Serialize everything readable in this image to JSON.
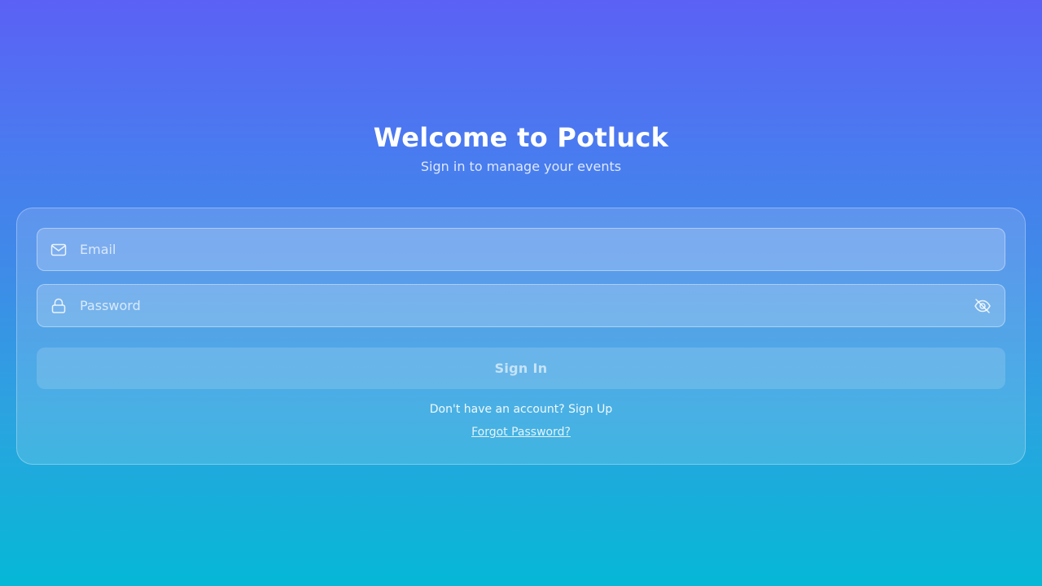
{
  "header": {
    "title": "Welcome to Potluck",
    "subtitle": "Sign in to manage your events"
  },
  "form": {
    "email": {
      "placeholder": "Email",
      "value": "",
      "icon": "mail-icon"
    },
    "password": {
      "placeholder": "Password",
      "value": "",
      "icon": "lock-icon",
      "toggle_icon": "eye-off-icon"
    },
    "submit_label": "Sign In",
    "signup_prompt": "Don't have an account?",
    "signup_link": "Sign Up",
    "forgot_link": "Forgot Password?"
  },
  "colors": {
    "gradient_top": "#5b61f5",
    "gradient_bottom": "#05b8d6",
    "text": "#ffffff"
  }
}
